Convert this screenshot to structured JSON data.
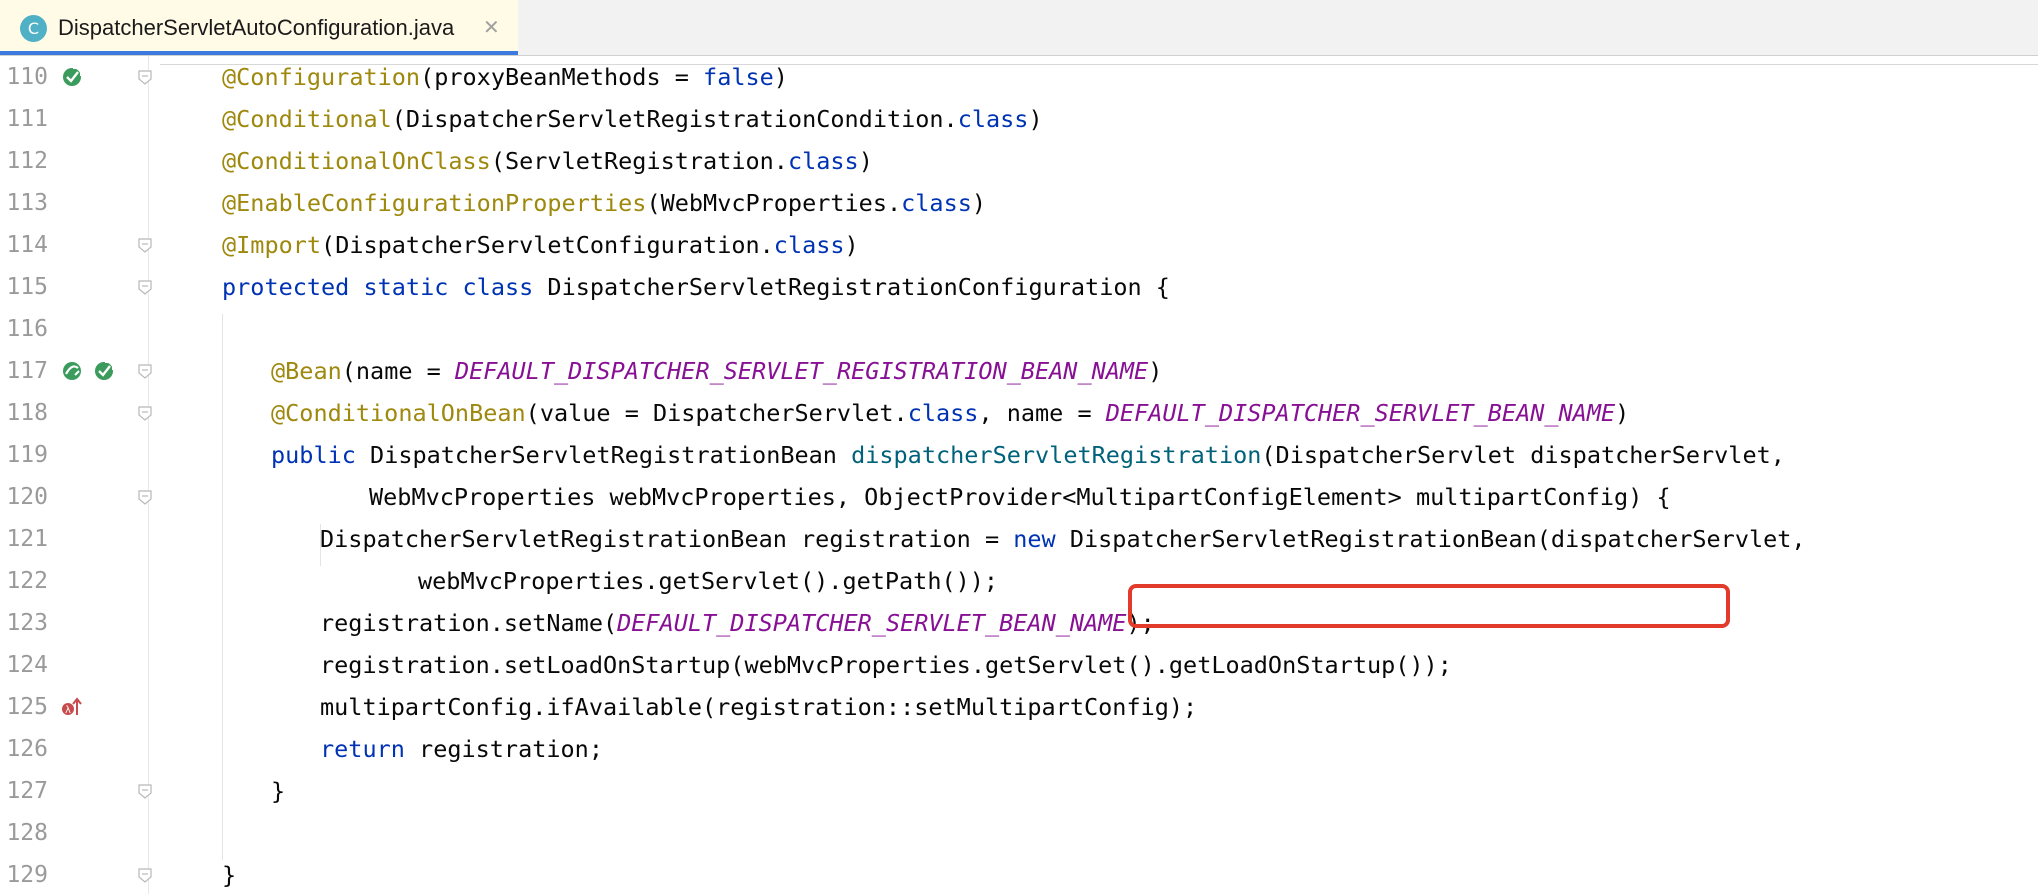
{
  "tab": {
    "icon_letter": "C",
    "filename": "DispatcherServletAutoConfiguration.java",
    "close_glyph": "✕"
  },
  "lines": [
    {
      "num": "110",
      "indent": 0,
      "tokens": [
        {
          "t": "ann",
          "v": "@Configuration"
        },
        {
          "t": "text",
          "v": "(proxyBeanMethods = "
        },
        {
          "t": "kw",
          "v": "false"
        },
        {
          "t": "text",
          "v": ")"
        }
      ]
    },
    {
      "num": "111",
      "indent": 0,
      "tokens": [
        {
          "t": "ann",
          "v": "@Conditional"
        },
        {
          "t": "text",
          "v": "(DispatcherServletRegistrationCondition."
        },
        {
          "t": "kw",
          "v": "class"
        },
        {
          "t": "text",
          "v": ")"
        }
      ]
    },
    {
      "num": "112",
      "indent": 0,
      "tokens": [
        {
          "t": "ann",
          "v": "@ConditionalOnClass"
        },
        {
          "t": "text",
          "v": "(ServletRegistration."
        },
        {
          "t": "kw",
          "v": "class"
        },
        {
          "t": "text",
          "v": ")"
        }
      ]
    },
    {
      "num": "113",
      "indent": 0,
      "tokens": [
        {
          "t": "ann",
          "v": "@EnableConfigurationProperties"
        },
        {
          "t": "text",
          "v": "(WebMvcProperties."
        },
        {
          "t": "kw",
          "v": "class"
        },
        {
          "t": "text",
          "v": ")"
        }
      ]
    },
    {
      "num": "114",
      "indent": 0,
      "tokens": [
        {
          "t": "ann",
          "v": "@Import"
        },
        {
          "t": "text",
          "v": "(DispatcherServletConfiguration."
        },
        {
          "t": "kw",
          "v": "class"
        },
        {
          "t": "text",
          "v": ")"
        }
      ]
    },
    {
      "num": "115",
      "indent": 0,
      "tokens": [
        {
          "t": "kw",
          "v": "protected static class "
        },
        {
          "t": "text",
          "v": "DispatcherServletRegistrationConfiguration {"
        }
      ]
    },
    {
      "num": "116",
      "indent": 0,
      "tokens": []
    },
    {
      "num": "117",
      "indent": 1,
      "tokens": [
        {
          "t": "ann",
          "v": "@Bean"
        },
        {
          "t": "text",
          "v": "(name = "
        },
        {
          "t": "const",
          "v": "DEFAULT_DISPATCHER_SERVLET_REGISTRATION_BEAN_NAME"
        },
        {
          "t": "text",
          "v": ")"
        }
      ]
    },
    {
      "num": "118",
      "indent": 1,
      "tokens": [
        {
          "t": "ann",
          "v": "@ConditionalOnBean"
        },
        {
          "t": "text",
          "v": "(value = DispatcherServlet."
        },
        {
          "t": "kw",
          "v": "class"
        },
        {
          "t": "text",
          "v": ", name = "
        },
        {
          "t": "const",
          "v": "DEFAULT_DISPATCHER_SERVLET_BEAN_NAME"
        },
        {
          "t": "text",
          "v": ")"
        }
      ]
    },
    {
      "num": "119",
      "indent": 1,
      "tokens": [
        {
          "t": "kw",
          "v": "public "
        },
        {
          "t": "text",
          "v": "DispatcherServletRegistrationBean "
        },
        {
          "t": "method",
          "v": "dispatcherServletRegistration"
        },
        {
          "t": "text",
          "v": "(DispatcherServlet dispatcherServlet,"
        }
      ]
    },
    {
      "num": "120",
      "indent": 3,
      "tokens": [
        {
          "t": "text",
          "v": "WebMvcProperties webMvcProperties, ObjectProvider<MultipartConfigElement> multipartConfig) {"
        }
      ]
    },
    {
      "num": "121",
      "indent": 2,
      "tokens": [
        {
          "t": "text",
          "v": "DispatcherServletRegistrationBean registration = "
        },
        {
          "t": "kw",
          "v": "new "
        },
        {
          "t": "text",
          "v": "DispatcherServletRegistrationBean(dispatcherServlet,"
        }
      ]
    },
    {
      "num": "122",
      "indent": 4,
      "tokens": [
        {
          "t": "text",
          "v": "webMvcProperties.getServlet().getPath());"
        }
      ]
    },
    {
      "num": "123",
      "indent": 2,
      "tokens": [
        {
          "t": "text",
          "v": "registration.setName("
        },
        {
          "t": "const",
          "v": "DEFAULT_DISPATCHER_SERVLET_BEAN_NAME"
        },
        {
          "t": "text",
          "v": ");"
        }
      ]
    },
    {
      "num": "124",
      "indent": 2,
      "tokens": [
        {
          "t": "text",
          "v": "registration.setLoadOnStartup(webMvcProperties.getServlet().getLoadOnStartup());"
        }
      ]
    },
    {
      "num": "125",
      "indent": 2,
      "tokens": [
        {
          "t": "text",
          "v": "multipartConfig.ifAvailable(registration::setMultipartConfig);"
        }
      ]
    },
    {
      "num": "126",
      "indent": 2,
      "tokens": [
        {
          "t": "kw",
          "v": "return "
        },
        {
          "t": "text",
          "v": "registration;"
        }
      ]
    },
    {
      "num": "127",
      "indent": 1,
      "tokens": [
        {
          "t": "text",
          "v": "}"
        }
      ]
    },
    {
      "num": "128",
      "indent": 0,
      "tokens": []
    },
    {
      "num": "129",
      "indent": 0,
      "tokens": [
        {
          "t": "text",
          "v": "}"
        }
      ]
    }
  ],
  "gutter_icons": [
    {
      "line": "110",
      "icons": [
        "bean-config-icon"
      ]
    },
    {
      "line": "117",
      "icons": [
        "bean-navigate-icon",
        "bean-config-icon"
      ]
    },
    {
      "line": "125",
      "icons": [
        "lambda-override-icon"
      ]
    }
  ],
  "fold_markers": [
    "110",
    "114",
    "115",
    "117",
    "118",
    "120",
    "127",
    "129"
  ],
  "colors": {
    "annotation": "#9e880d",
    "keyword": "#0033b3",
    "constant": "#871094",
    "method": "#00627a",
    "highlight_border": "#e23b2c",
    "tab_active": "#3d7ae0"
  }
}
